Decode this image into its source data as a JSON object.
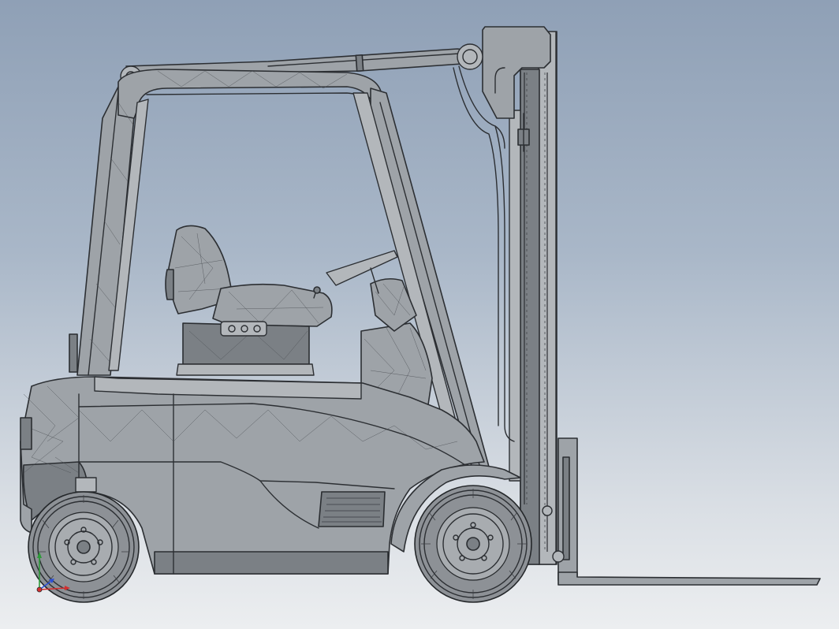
{
  "view": {
    "background_top": "#8fa0b6",
    "background_bottom": "#eceef0",
    "model_color": "#9ea3a8",
    "edge_color": "#2c2f33"
  },
  "triad": {
    "x_axis_color": "#d23030",
    "y_axis_color": "#2e9a3a",
    "z_axis_color": "#2b4fd6"
  }
}
